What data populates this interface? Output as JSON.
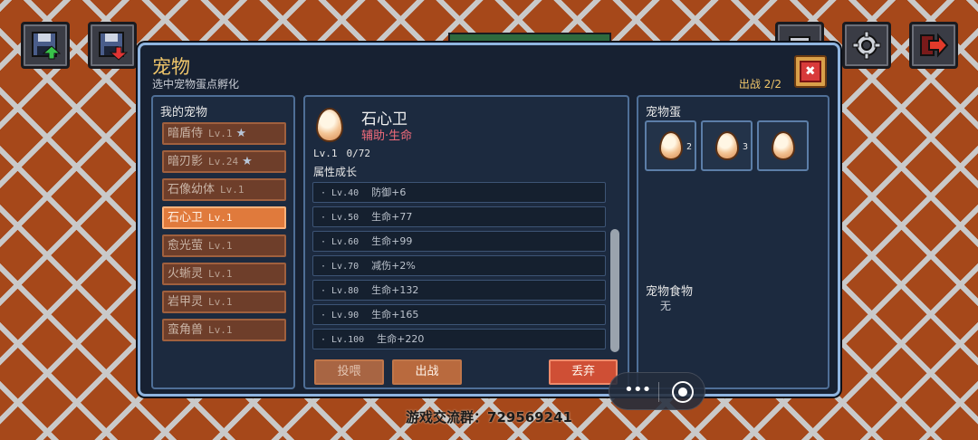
{
  "hud": {
    "icons": [
      "save-upload-icon",
      "save-download-icon",
      "hud-center-icon",
      "gear-icon",
      "exit-arrow-icon"
    ],
    "colors": {
      "background": "#a6481a",
      "lattice": "#c9c9c9"
    }
  },
  "modal": {
    "title": "宠物",
    "subtitle": "选中宠物蛋点孵化",
    "deploy_count": "出战 2/2",
    "close_label": "✖"
  },
  "my_pets": {
    "label": "我的宠物",
    "items": [
      {
        "name": "暗盾侍",
        "level": "Lv.1",
        "star": "★"
      },
      {
        "name": "暗刃影",
        "level": "Lv.24",
        "star": "★"
      },
      {
        "name": "石像幼体",
        "level": "Lv.1",
        "star": ""
      },
      {
        "name": "石心卫",
        "level": "Lv.1",
        "star": ""
      },
      {
        "name": "愈光萤",
        "level": "Lv.1",
        "star": ""
      },
      {
        "name": "火蜥灵",
        "level": "Lv.1",
        "star": ""
      },
      {
        "name": "岩甲灵",
        "level": "Lv.1",
        "star": ""
      },
      {
        "name": "蛮角兽",
        "level": "Lv.1",
        "star": ""
      }
    ],
    "selected_index": 3
  },
  "detail": {
    "name": "石心卫",
    "tags": "辅助·生命",
    "level": "Lv.1",
    "exp": "0/72",
    "growth_label": "属性成长",
    "growth": [
      {
        "level": "· Lv.40",
        "bonus": "防御+6"
      },
      {
        "level": "· Lv.50",
        "bonus": "生命+77"
      },
      {
        "level": "· Lv.60",
        "bonus": "生命+99"
      },
      {
        "level": "· Lv.70",
        "bonus": "减伤+2%"
      },
      {
        "level": "· Lv.80",
        "bonus": "生命+132"
      },
      {
        "level": "· Lv.90",
        "bonus": "生命+165"
      },
      {
        "level": "· Lv.100",
        "bonus": "生命+220"
      }
    ],
    "buttons": {
      "feed": "投喂",
      "deploy": "出战",
      "discard": "丢弃"
    }
  },
  "eggs": {
    "label": "宠物蛋",
    "slots": [
      {
        "count": "2"
      },
      {
        "count": "3"
      },
      {
        "count": ""
      }
    ]
  },
  "food": {
    "label": "宠物食物",
    "value": "无"
  },
  "capsule": {
    "more": "•••"
  },
  "footer": "游戏交流群：729569241"
}
